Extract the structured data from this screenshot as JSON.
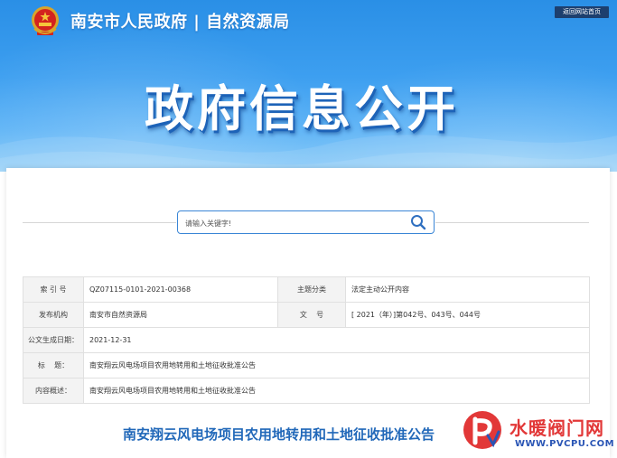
{
  "header": {
    "site_title": "南安市人民政府 | 自然资源局",
    "home_link": "返回网站首页",
    "banner_title": "政府信息公开"
  },
  "search": {
    "placeholder": "请输入关键字!"
  },
  "info_table": {
    "rows": [
      {
        "label1": "索 引 号",
        "value1": "QZ07115-0101-2021-00368",
        "label2": "主题分类",
        "value2": "法定主动公开内容"
      },
      {
        "label1": "发布机构",
        "value1": "南安市自然资源局",
        "label2": "文    号",
        "value2": "[ 2021（年）]第042号、043号、044号"
      },
      {
        "label1": "公文生成日期：",
        "value1": "2021-12-31"
      },
      {
        "label1": "标    题：",
        "value1": "南安翔云风电场项目农用地转用和土地征收批准公告"
      },
      {
        "label1": "内容概述：",
        "value1": "南安翔云风电场项目农用地转用和土地征收批准公告"
      }
    ]
  },
  "article": {
    "title": "南安翔云风电场项目农用地转用和土地征收批准公告"
  },
  "watermark": {
    "name": "水暖阀门网",
    "url": "WWW.PVCPU.COM"
  },
  "colors": {
    "banner_blue": "#3d9ff0",
    "title_blue": "#2168b9",
    "search_border": "#3a86d6",
    "watermark_red": "#e23838"
  },
  "icons": {
    "emblem": "national-emblem-icon",
    "search": "search-icon",
    "watermark_logo": "watermark-logo-icon"
  }
}
